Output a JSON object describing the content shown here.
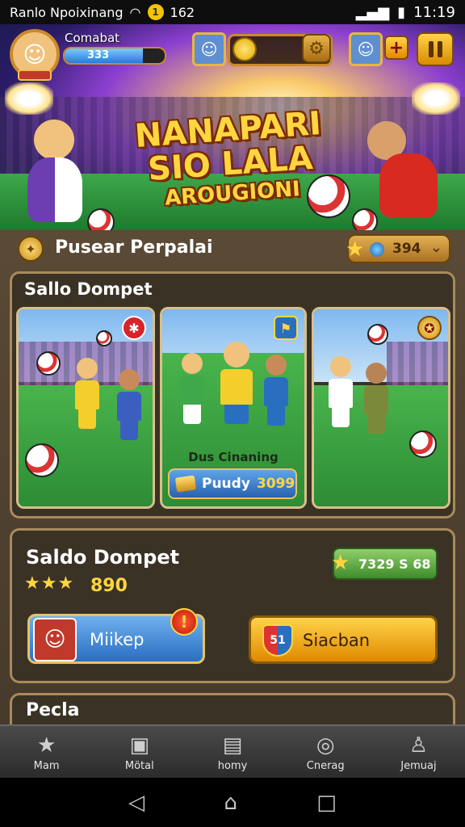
{
  "status_bar": {
    "carrier": "Ranlo Npoixinang",
    "coins": "162",
    "time": "11:19"
  },
  "hud": {
    "player_name": "Comabat",
    "xp_value": "333",
    "xp_fraction": 0.78
  },
  "hero": {
    "title_line1": "NANAPARI",
    "title_line2": "SIO LALA",
    "title_line3": "AROUGIONI"
  },
  "section": {
    "title": "Pusear Perpalai",
    "currency_value": "394"
  },
  "card1": {
    "title": "Sallo Dompet",
    "tiles": [
      {
        "badge": "star"
      },
      {
        "caption": "Dus Cinaning",
        "button_label": "Puudy",
        "button_amount": "3099"
      },
      {
        "badge": "medal"
      }
    ]
  },
  "card2": {
    "title": "Saldo Dompet",
    "stars": 3,
    "score": "890",
    "pill_value": "7329 S 68",
    "button_left": "Miikep",
    "button_right": "Siacban",
    "shield_text": "51"
  },
  "card3": {
    "title": "Pecla"
  },
  "bottom_nav": [
    {
      "label": "Mam",
      "icon": "star-icon"
    },
    {
      "label": "Mötal",
      "icon": "portrait-icon"
    },
    {
      "label": "homy",
      "icon": "jersey-icon"
    },
    {
      "label": "Cnerag",
      "icon": "ball-icon"
    },
    {
      "label": "Jemuaj",
      "icon": "user-icon"
    }
  ],
  "colors": {
    "accent_gold": "#ffd640",
    "panel_brown": "#4f4030",
    "button_blue": "#2a6ec0"
  }
}
